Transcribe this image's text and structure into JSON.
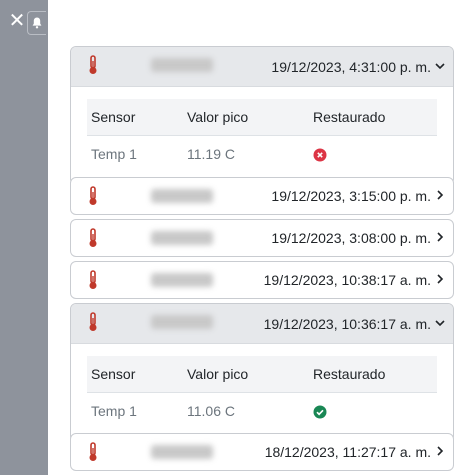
{
  "table_headers": {
    "sensor": "Sensor",
    "peak": "Valor pico",
    "restored": "Restaurado"
  },
  "alerts": [
    {
      "date": "19/12/2023, 4:31:00 p. m.",
      "expanded": true,
      "row": {
        "sensor": "Temp 1",
        "peak": "11.19 C",
        "restored": false
      }
    },
    {
      "date": "19/12/2023, 3:15:00 p. m.",
      "expanded": false
    },
    {
      "date": "19/12/2023, 3:08:00 p. m.",
      "expanded": false
    },
    {
      "date": "19/12/2023, 10:38:17 a. m.",
      "expanded": false
    },
    {
      "date": "19/12/2023, 10:36:17 a. m.",
      "expanded": true,
      "row": {
        "sensor": "Temp 1",
        "peak": "11.06 C",
        "restored": true
      }
    },
    {
      "date": "18/12/2023, 11:27:17 a. m.",
      "expanded": false
    }
  ],
  "colors": {
    "thermometer": "#c0392b",
    "not_restored": "#dc3545",
    "restored": "#198754"
  },
  "icons": {
    "thermometer": "thermometer-icon",
    "close": "close-icon",
    "bell": "bell-icon"
  }
}
